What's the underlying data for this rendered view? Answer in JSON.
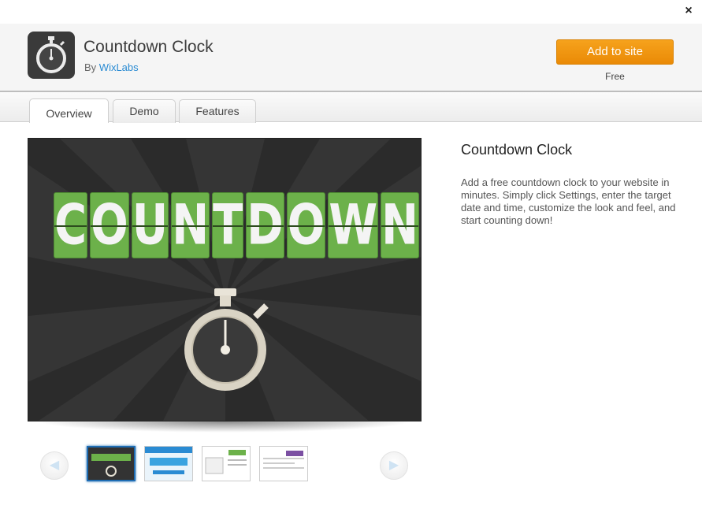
{
  "window": {
    "close_label": "×"
  },
  "header": {
    "app_title": "Countdown Clock",
    "by_prefix": "By",
    "author": "WixLabs",
    "add_button": "Add to site",
    "price": "Free",
    "icon": "stopwatch-icon"
  },
  "tabs": [
    {
      "label": "Overview",
      "active": true
    },
    {
      "label": "Demo",
      "active": false
    },
    {
      "label": "Features",
      "active": false
    }
  ],
  "hero": {
    "letters": [
      "C",
      "O",
      "U",
      "N",
      "T",
      "D",
      "O",
      "W",
      "N"
    ],
    "icon": "stopwatch-icon"
  },
  "description": {
    "title": "Countdown Clock",
    "text": "Add a free countdown clock to your website in minutes. Simply click Settings, enter the target date and time, customize the look and feel, and start counting down!"
  },
  "gallery": {
    "prev_icon": "chevron-left-icon",
    "next_icon": "chevron-right-icon",
    "prev_label": "◀",
    "next_label": "▶",
    "thumbnail_count": 4,
    "active_index": 0
  },
  "colors": {
    "accent_orange": "#f39814",
    "link_blue": "#2a8bd3",
    "tile_green": "#6cb14a",
    "hero_background": "#353535"
  }
}
